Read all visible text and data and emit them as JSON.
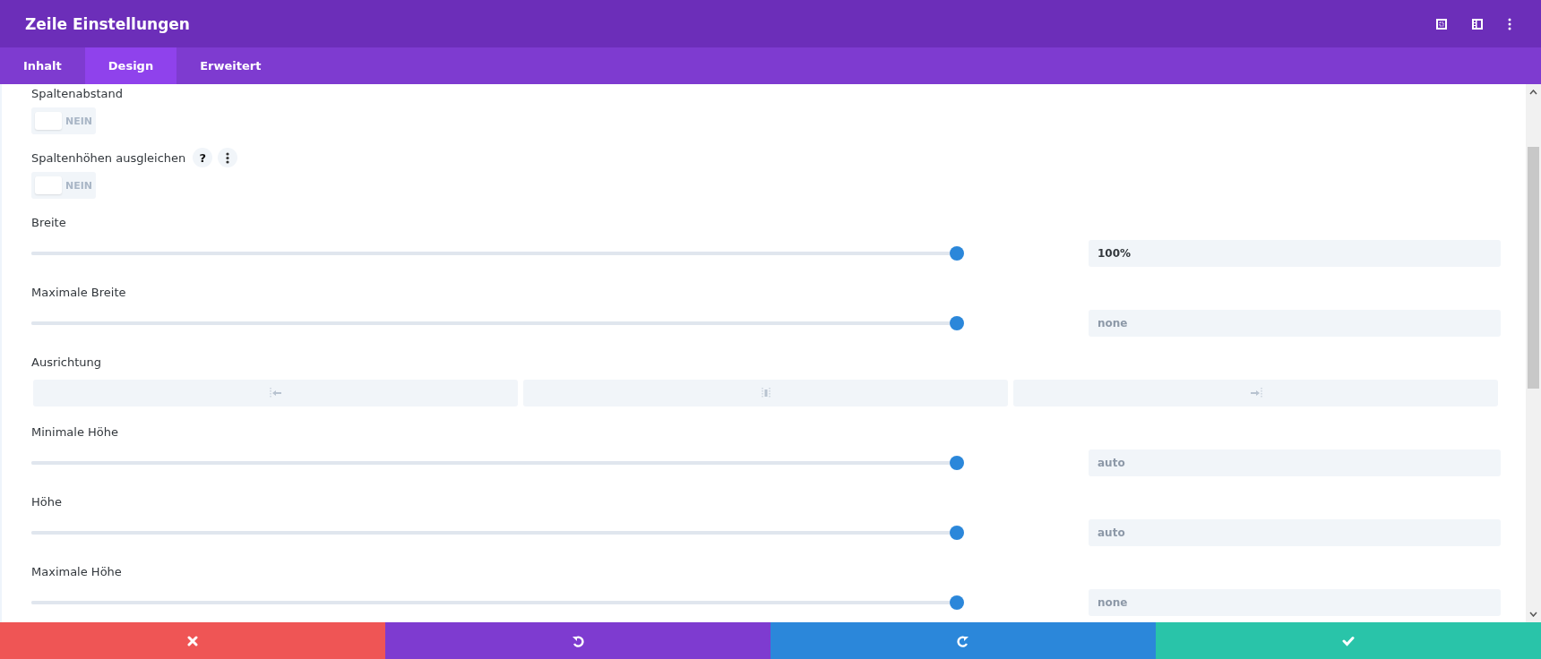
{
  "window": {
    "title": "Zeile Einstellungen"
  },
  "tabs": [
    {
      "label": "Inhalt",
      "selected": false
    },
    {
      "label": "Design",
      "selected": true
    },
    {
      "label": "Erweitert",
      "selected": false
    }
  ],
  "settings": [
    {
      "kind": "toggle",
      "label": "Spaltenabstand",
      "on": false,
      "state_text": "NEIN"
    },
    {
      "kind": "toggle",
      "label": "Spaltenhöhen ausgleichen",
      "on": false,
      "state_text": "NEIN",
      "help": "?"
    },
    {
      "kind": "slider",
      "label": "Breite",
      "level": 1,
      "value": "100%"
    },
    {
      "kind": "slider",
      "label": "Maximale Breite",
      "level": 1,
      "placeholder": "none"
    },
    {
      "kind": "align",
      "label": "Ausrichtung",
      "options": [
        {
          "selected": false
        },
        {
          "selected": false
        },
        {
          "selected": false
        }
      ]
    },
    {
      "kind": "slider",
      "label": "Minimale Höhe",
      "level": 1,
      "placeholder": "auto"
    },
    {
      "kind": "slider",
      "label": "Höhe",
      "level": 1,
      "placeholder": "auto"
    },
    {
      "kind": "slider",
      "label": "Maximale Höhe",
      "level": 1,
      "placeholder": "none"
    }
  ]
}
